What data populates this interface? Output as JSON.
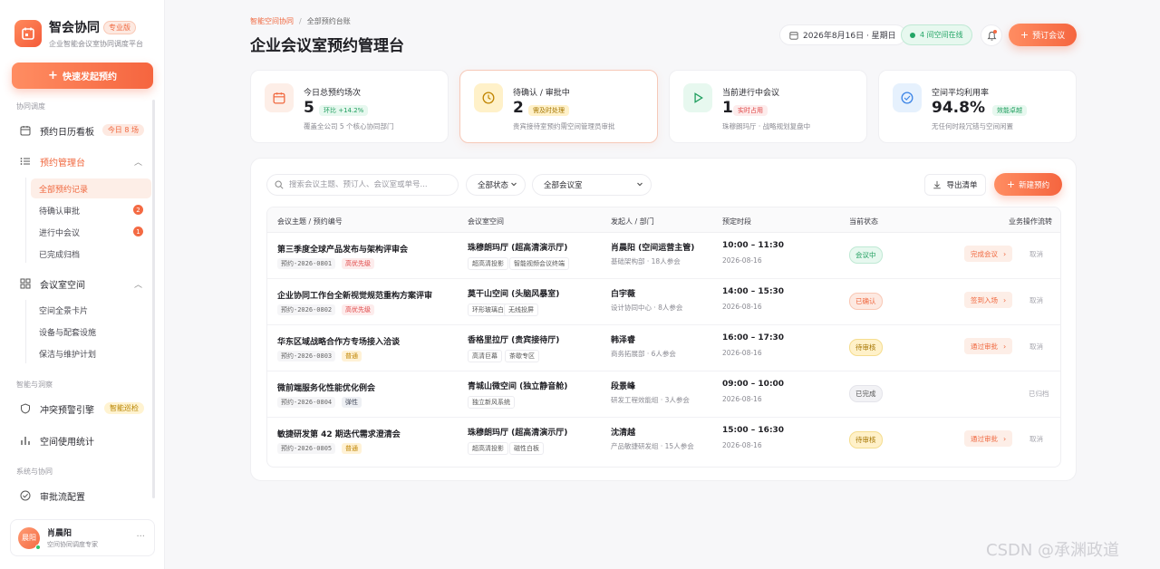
{
  "brand": {
    "name": "智会协同",
    "badge": "专业版",
    "subtitle": "企业智能会议室协同调度平台"
  },
  "sidebar": {
    "quick_button": "快速发起预约",
    "section_scheduling": "协同调度",
    "calendar": {
      "label": "预约日历看板",
      "badge": "今日 8 场"
    },
    "booking_mgmt": {
      "label": "预约管理台"
    },
    "booking_sub": [
      {
        "label": "全部预约记录"
      },
      {
        "label": "待确认审批",
        "count": "2"
      },
      {
        "label": "进行中会议",
        "count": "1"
      },
      {
        "label": "已完成归档"
      }
    ],
    "room_space": {
      "label": "会议室空间"
    },
    "room_sub": [
      {
        "label": "空间全景卡片"
      },
      {
        "label": "设备与配套设施"
      },
      {
        "label": "保洁与维护计划"
      }
    ],
    "section_smart": "智能与洞察",
    "conflict": {
      "label": "冲突预警引擎",
      "badge": "智能巡检"
    },
    "usage": {
      "label": "空间使用统计"
    },
    "section_system": "系统与协同",
    "approval": {
      "label": "审批流配置"
    },
    "user": {
      "avatar": "晨阳",
      "name": "肖晨阳",
      "role": "空间协同调度专家"
    }
  },
  "header": {
    "breadcrumb_root": "智能空间协同",
    "breadcrumb_current": "全部预约台账",
    "title": "企业会议室预约管理台",
    "date": "2026年8月16日 · 星期日",
    "online": "4 间空间在线",
    "book_button": "预订会议"
  },
  "stats": [
    {
      "label": "今日总预约场次",
      "value": "5",
      "tag": "环比 +14.2%",
      "desc": "覆盖全公司 5 个核心协同部门"
    },
    {
      "label": "待确认 / 审批中",
      "value": "2",
      "tag": "需及时处理",
      "desc": "贵宾接待室预约需空间管理员审批"
    },
    {
      "label": "当前进行中会议",
      "value": "1",
      "tag": "实时占用",
      "desc": "珠穆朗玛厅 · 战略规划复盘中"
    },
    {
      "label": "空间平均利用率",
      "value": "94.8%",
      "tag": "效能卓越",
      "desc": "无任何时段冗错与空间闲置"
    }
  ],
  "toolbar": {
    "search_placeholder": "搜索会议主题、预订人、会议室或单号...",
    "status_filter": "全部状态",
    "room_filter": "全部会议室",
    "export": "导出清单",
    "new": "新建预约"
  },
  "table": {
    "headers": [
      "会议主题 / 预约编号",
      "会议室空间",
      "发起人 / 部门",
      "预定时段",
      "当前状态",
      "业务操作流转"
    ],
    "rows": [
      {
        "title": "第三季度全球产品发布与架构评审会",
        "id": "预约-2026-0801",
        "priority": "高优先级",
        "pri": "high",
        "room": "珠穆朗玛厅 (超高清演示厅)",
        "facilities": [
          "超高清投影",
          "智能视频会议终端"
        ],
        "person": "肖晨阳 (空间运营主管)",
        "dept": "基础架构部 · 18人参会",
        "time": "10:00 – 11:30",
        "date": "2026-08-16",
        "status": "会议中",
        "st": "live",
        "action": "完成会议",
        "cancel": "取消"
      },
      {
        "title": "企业协同工作台全新视觉规范重构方案评审",
        "id": "预约-2026-0802",
        "priority": "高优先级",
        "pri": "high",
        "room": "莫干山空间 (头脑风暴室)",
        "facilities": [
          "环形玻璃白板",
          "无线投屏"
        ],
        "person": "白宇薇",
        "dept": "设计协同中心 · 8人参会",
        "time": "14:00 – 15:30",
        "date": "2026-08-16",
        "status": "已确认",
        "st": "ok",
        "action": "签到入场",
        "cancel": "取消"
      },
      {
        "title": "华东区域战略合作方专场接入洽谈",
        "id": "预约-2026-0803",
        "priority": "普通",
        "pri": "normal",
        "room": "香格里拉厅 (贵宾接待厅)",
        "facilities": [
          "高清巨幕",
          "茶歇专区"
        ],
        "person": "韩泽睿",
        "dept": "商务拓展部 · 6人参会",
        "time": "16:00 – 17:30",
        "date": "2026-08-16",
        "status": "待审核",
        "st": "wait",
        "action": "通过审批",
        "cancel": "取消"
      },
      {
        "title": "微前端服务化性能优化例会",
        "id": "预约-2026-0804",
        "priority": "弹性",
        "pri": "flex",
        "room": "青城山微空间 (独立静音舱)",
        "facilities": [
          "独立新风系统"
        ],
        "person": "段景峰",
        "dept": "研发工程效能组 · 3人参会",
        "time": "09:00 – 10:00",
        "date": "2026-08-16",
        "status": "已完成",
        "st": "done",
        "archived": "已归档"
      },
      {
        "title": "敏捷研发第 42 期迭代需求澄清会",
        "id": "预约-2026-0805",
        "priority": "普通",
        "pri": "normal",
        "room": "珠穆朗玛厅 (超高清演示厅)",
        "facilities": [
          "超高清投影",
          "磁性白板"
        ],
        "person": "沈清越",
        "dept": "产品敏捷研发组 · 15人参会",
        "time": "15:00 – 16:30",
        "date": "2026-08-16",
        "status": "待审核",
        "st": "wait",
        "action": "通过审批",
        "cancel": "取消"
      }
    ]
  },
  "watermark": "CSDN @承渊政道"
}
